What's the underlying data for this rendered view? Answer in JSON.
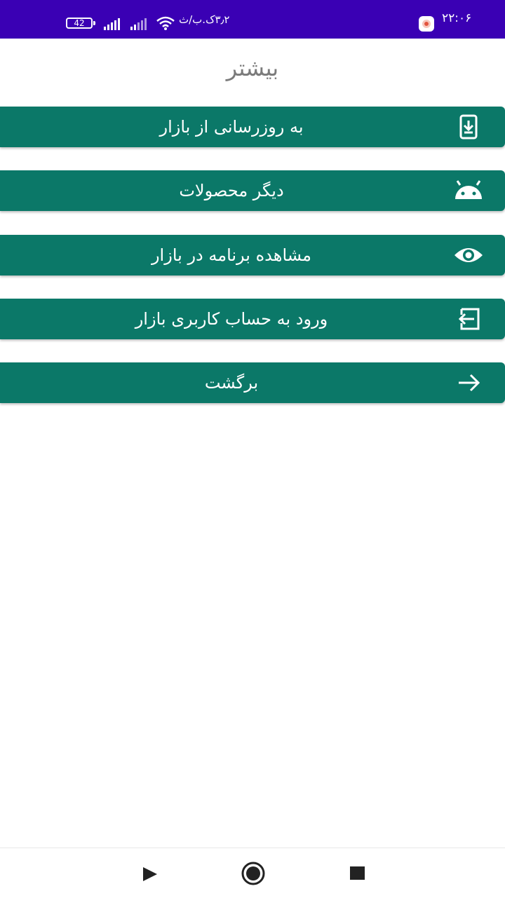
{
  "status_bar": {
    "time": "۲۲:۰۶",
    "net_speed": "۳٫۲ک.ب/ث",
    "battery": "42"
  },
  "page": {
    "title": "بیشتر"
  },
  "menu": {
    "items": [
      {
        "label": "به روزرسانی از بازار",
        "icon": "download-phone-icon"
      },
      {
        "label": "دیگر محصولات",
        "icon": "android-icon"
      },
      {
        "label": "مشاهده برنامه در بازار",
        "icon": "eye-icon"
      },
      {
        "label": "ورود به حساب کاربری بازار",
        "icon": "login-icon"
      },
      {
        "label": "برگشت",
        "icon": "arrow-right-icon"
      }
    ]
  },
  "colors": {
    "status_bar": "#3a00b4",
    "button": "#0b7868",
    "title": "#7b7b7b"
  }
}
